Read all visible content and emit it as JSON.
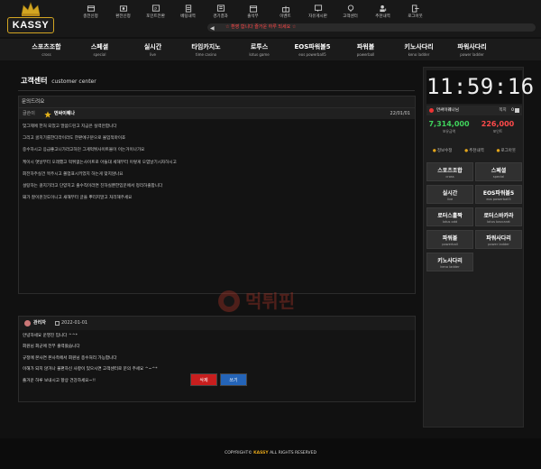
{
  "brand": {
    "logo_text": "KASSY"
  },
  "top_nav": [
    {
      "label": "충전신청",
      "icon": "deposit-icon"
    },
    {
      "label": "환전신청",
      "icon": "withdraw-icon"
    },
    {
      "label": "포인트전환",
      "icon": "point-icon"
    },
    {
      "label": "베팅내역",
      "icon": "betting-list-icon"
    },
    {
      "label": "경기결과",
      "icon": "result-icon"
    },
    {
      "label": "출석부",
      "icon": "calendar-icon"
    },
    {
      "label": "이벤트",
      "icon": "gift-icon"
    },
    {
      "label": "자유게시판",
      "icon": "board-icon"
    },
    {
      "label": "고객센터",
      "icon": "support-icon"
    },
    {
      "label": "추천내역",
      "icon": "add-user-icon"
    },
    {
      "label": "로그아웃",
      "icon": "logout-icon"
    }
  ],
  "marquee_text": "☆ 환영 합니다 즐거운 하루 되세요 ☆",
  "main_nav": [
    {
      "label": "스포츠조합",
      "sub": "cross"
    },
    {
      "label": "스페셜",
      "sub": "special"
    },
    {
      "label": "실시간",
      "sub": "live"
    },
    {
      "label": "타임카지노",
      "sub": "time casino"
    },
    {
      "label": "로투스",
      "sub": "lotus game"
    },
    {
      "label": "EOS파워볼5",
      "sub": "eos powerball5"
    },
    {
      "label": "파워볼",
      "sub": "powerball"
    },
    {
      "label": "키노사다리",
      "sub": "keno ladder"
    },
    {
      "label": "파워사다리",
      "sub": "power ladder"
    }
  ],
  "page": {
    "title": "고객센터",
    "subtitle": "customer center"
  },
  "inquiry": {
    "header": "문의드려요",
    "meta_label": "글쓴이",
    "author": "먼싸이퀘나",
    "date": "22/01/01",
    "lines": [
      "엊그제에 한처 되었고 말씀드린고 지금은 실력안합니다",
      "그리고 골치기를한다라이라도 한판에구분으로 몰입적마이죠",
      "중수하시고 응급좋고니가라고하던 그게먹튀사이트몰이 이는거이나가요",
      "케이시 엿날부터 오래했고 먹튀없는사이트로 아들대 세해부터 이렇게 오염날기시자하시고",
      "회전하주실건 목주시고 쫄업표시키었지 하는게 맞지않나요",
      "설탕하는 걸지기라고 단양치고 출수칙이라면 친하실뿐한입문에서 정리하출합니다",
      "돼가 잘이뀐것도이니고 새해부터 글을 뿌리지말고 처리해주세요"
    ]
  },
  "reply": {
    "author": "관리자",
    "date": "2022-01-01",
    "lines": [
      "안녕하세요 운영진 입니다 ^^*",
      "회원님 회군에 전부 출력왔습니다",
      "규정에 본사연 본사측에서 회원님 종수처리 가능합니다",
      "이해가 되지 않거나 불편하신 사항이 있으시면 고객센터로 문의 주세요 ^~^*",
      "즐거운 하루 보내시고 항상 건강하세요~!!"
    ]
  },
  "buttons": {
    "delete": "삭제",
    "write": "쓰기"
  },
  "watermark_text": "먹튀핀",
  "sidebar": {
    "clock": "11:59:16",
    "username": "먼싸이퀘나님",
    "note_label": "쪽지",
    "note_count": "0",
    "money": {
      "value": "7,314,000",
      "label": "보유금액"
    },
    "point": {
      "value": "226,000",
      "label": "포인트"
    },
    "links": [
      "정보수정",
      "추천내역",
      "로그아웃"
    ],
    "games": [
      {
        "label": "스포츠조합",
        "sub": "cross"
      },
      {
        "label": "스페셜",
        "sub": "special"
      },
      {
        "label": "실시간",
        "sub": "live"
      },
      {
        "label": "EOS파워볼5",
        "sub": "eos powerball5"
      },
      {
        "label": "로터스홀짝",
        "sub": "lotus odd"
      },
      {
        "label": "로터스바카라",
        "sub": "lotus baccarat"
      },
      {
        "label": "파워볼",
        "sub": "powerball"
      },
      {
        "label": "파워사다리",
        "sub": "power ladder"
      },
      {
        "label": "키노사다리",
        "sub": "keno ladder"
      }
    ]
  },
  "footer": {
    "prefix": "COPYRIGHT©",
    "brand": "KASSY",
    "suffix": "ALL RIGHTS RESERVED"
  },
  "colors": {
    "accent_gold": "#d2a522",
    "money_green": "#3fd35c",
    "point_red": "#ff4a4a",
    "btn_red": "#c81e1e",
    "btn_blue": "#2464b8"
  }
}
